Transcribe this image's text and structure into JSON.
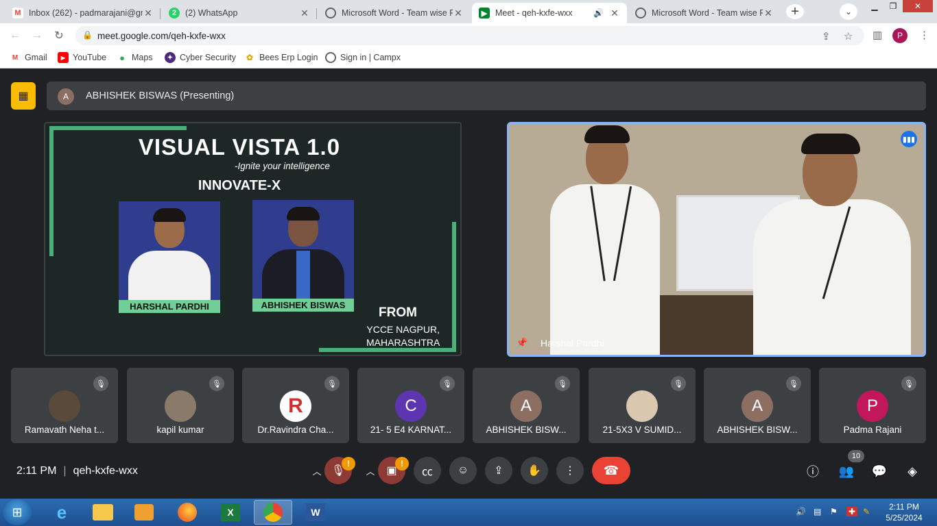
{
  "browser": {
    "tabs": [
      {
        "title": "Inbox (262) - padmarajani@gm",
        "favicon": "gmail-icon",
        "active": false
      },
      {
        "title": "(2) WhatsApp",
        "favicon": "whatsapp-icon",
        "active": false
      },
      {
        "title": "Microsoft Word - Team wise Pr",
        "favicon": "globe-icon",
        "active": false
      },
      {
        "title": "Meet - qeh-kxfe-wxx",
        "favicon": "meet-icon",
        "active": true
      },
      {
        "title": "Microsoft Word - Team wise Pr",
        "favicon": "globe-icon",
        "active": false
      }
    ],
    "url": "meet.google.com/qeh-kxfe-wxx",
    "profile_initial": "P",
    "bookmarks": [
      {
        "label": "Gmail",
        "icon": "gmail-icon"
      },
      {
        "label": "YouTube",
        "icon": "youtube-icon"
      },
      {
        "label": "Maps",
        "icon": "maps-icon"
      },
      {
        "label": "Cyber Security",
        "icon": "cyber-icon"
      },
      {
        "label": "Bees Erp Login",
        "icon": "bee-icon"
      },
      {
        "label": "Sign in | Campx",
        "icon": "globe-icon"
      }
    ]
  },
  "meet": {
    "presenter_initial": "A",
    "presenting_text": "ABHISHEK BISWAS (Presenting)",
    "slide": {
      "title": "VISUAL VISTA 1.0",
      "subtitle": "-Ignite your intelligence",
      "team": "INNOVATE-X",
      "member1": "HARSHAL PARDHI",
      "member2": "ABHISHEK BISWAS",
      "from_label": "FROM",
      "college_line1": "YCCE NAGPUR,",
      "college_line2": "MAHARASHTRA"
    },
    "spotlight_name": "Harshal Pardhi",
    "participants": [
      {
        "name": "Ramavath Neha t...",
        "initial": "",
        "color": "#5a4a3a"
      },
      {
        "name": "kapil kumar",
        "initial": "",
        "color": "#8a7a6a"
      },
      {
        "name": "Dr.Ravindra Cha...",
        "initial": "R",
        "color": "#ffffff"
      },
      {
        "name": "21- 5 E4 KARNAT...",
        "initial": "C",
        "color": "#5e35b1"
      },
      {
        "name": "ABHISHEK BISW...",
        "initial": "A",
        "color": "#8d6e63"
      },
      {
        "name": "21-5X3 V SUMID...",
        "initial": "",
        "color": "#d9c7b0"
      },
      {
        "name": "ABHISHEK BISW...",
        "initial": "A",
        "color": "#8d6e63"
      },
      {
        "name": "Padma Rajani",
        "initial": "P",
        "color": "#c2185b"
      }
    ],
    "time": "2:11 PM",
    "meeting_code": "qeh-kxfe-wxx",
    "people_count": "10",
    "alert_badge": "!"
  },
  "taskbar": {
    "time": "2:11 PM",
    "date": "5/25/2024"
  }
}
